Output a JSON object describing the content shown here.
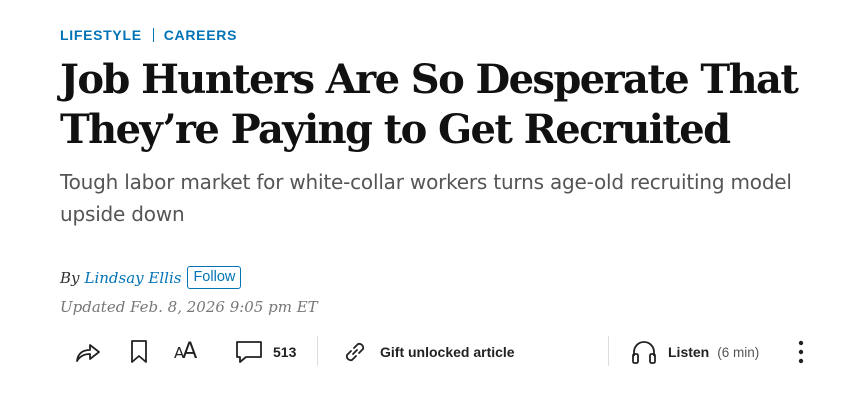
{
  "sections": {
    "primary": "LIFESTYLE",
    "secondary": "CAREERS"
  },
  "article": {
    "headline": "Job Hunters Are So Desperate That They’re Paying to Get Recruited",
    "dek": "Tough labor market for white-collar workers turns age-old recruiting model upside down",
    "byline_prefix": "By",
    "author": "Lindsay Ellis",
    "follow_label": "Follow",
    "timestamp": "Updated Feb. 8, 2026 9:05 pm ET"
  },
  "toolbar": {
    "share_icon": "share-icon",
    "bookmark_icon": "bookmark-icon",
    "text_size_icon": "text-size-icon",
    "text_size_glyph_small": "A",
    "text_size_glyph_large": "A",
    "comment_icon": "comment-icon",
    "comment_count": "513",
    "gift_icon": "link-icon",
    "gift_label": "Gift unlocked article",
    "listen_icon": "headphones-icon",
    "listen_label": "Listen",
    "listen_duration": "(6 min)",
    "more_icon": "more-vertical-icon"
  },
  "colors": {
    "accent": "#0274b6",
    "headline": "#111111",
    "dek": "#555555",
    "timestamp": "#777777",
    "divider": "#dddddd"
  }
}
